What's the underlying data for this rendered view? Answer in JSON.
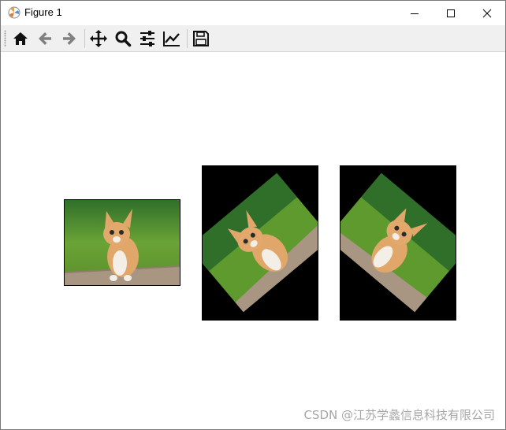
{
  "window": {
    "title": "Figure 1"
  },
  "toolbar": {
    "buttons": [
      {
        "name": "home",
        "icon": "home-icon"
      },
      {
        "name": "back",
        "icon": "arrow-left-icon"
      },
      {
        "name": "forward",
        "icon": "arrow-right-icon"
      },
      {
        "name": "pan",
        "icon": "move-icon"
      },
      {
        "name": "zoom",
        "icon": "magnifier-icon"
      },
      {
        "name": "subplots",
        "icon": "sliders-icon"
      },
      {
        "name": "customize",
        "icon": "line-chart-icon"
      },
      {
        "name": "save",
        "icon": "floppy-disk-icon"
      }
    ]
  },
  "figure": {
    "panels": [
      {
        "name": "original",
        "rotation_deg": 0
      },
      {
        "name": "rotated-left",
        "rotation_deg": -40
      },
      {
        "name": "rotated-right",
        "rotation_deg": 40
      }
    ]
  },
  "watermark": "CSDN @江苏学蠡信息科技有限公司",
  "colors": {
    "toolbar_bg": "#f0f0f0",
    "grass": "#5f9a2e",
    "kitten_fur": "#e0a66a",
    "wood": "#a89683"
  }
}
